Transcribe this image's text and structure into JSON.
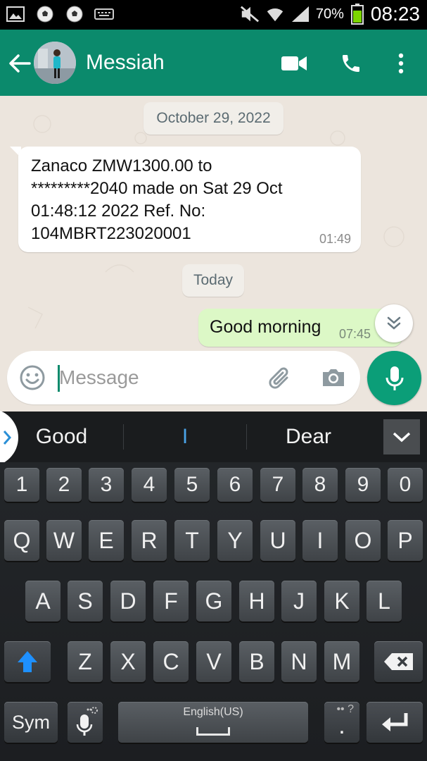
{
  "status_bar": {
    "battery_percent": "70%",
    "time": "08:23",
    "left_icons": [
      "gallery-icon",
      "soccer-ball-icon",
      "soccer-ball-icon",
      "keyboard-icon"
    ],
    "right_icons": [
      "mute-icon",
      "wifi-icon",
      "signal-icon",
      "battery-icon"
    ]
  },
  "header": {
    "contact_name": "Messiah",
    "icons": [
      "back-arrow-icon",
      "video-call-icon",
      "voice-call-icon",
      "more-vert-icon"
    ]
  },
  "chat": {
    "date_label_1": "October 29, 2022",
    "incoming_message": {
      "text": "Zanaco ZMW1300.00 to\n*********2040 made on Sat 29 Oct\n01:48:12 2022 Ref. No:\n104MBRT223020001",
      "time": "01:49"
    },
    "date_label_2": "Today",
    "outgoing_message": {
      "text": "Good morning",
      "time": "07:45"
    }
  },
  "composer": {
    "placeholder": "Message",
    "icons": [
      "emoji-icon",
      "paperclip-icon",
      "camera-icon",
      "mic-icon"
    ]
  },
  "suggestions": {
    "items": [
      "Good",
      "I",
      "Dear"
    ]
  },
  "keyboard": {
    "number_row": [
      "1",
      "2",
      "3",
      "4",
      "5",
      "6",
      "7",
      "8",
      "9",
      "0"
    ],
    "row1": [
      "Q",
      "W",
      "E",
      "R",
      "T",
      "Y",
      "U",
      "I",
      "O",
      "P"
    ],
    "row2": [
      "A",
      "S",
      "D",
      "F",
      "G",
      "H",
      "J",
      "K",
      "L"
    ],
    "row3": [
      "Z",
      "X",
      "C",
      "V",
      "B",
      "N",
      "M"
    ],
    "sym_label": "Sym",
    "space_label": "English(US)",
    "period_label": ".",
    "colors": {
      "shift_arrow": "#1e90ff",
      "accent": "#0b9e78",
      "header": "#0b8a6c"
    }
  }
}
